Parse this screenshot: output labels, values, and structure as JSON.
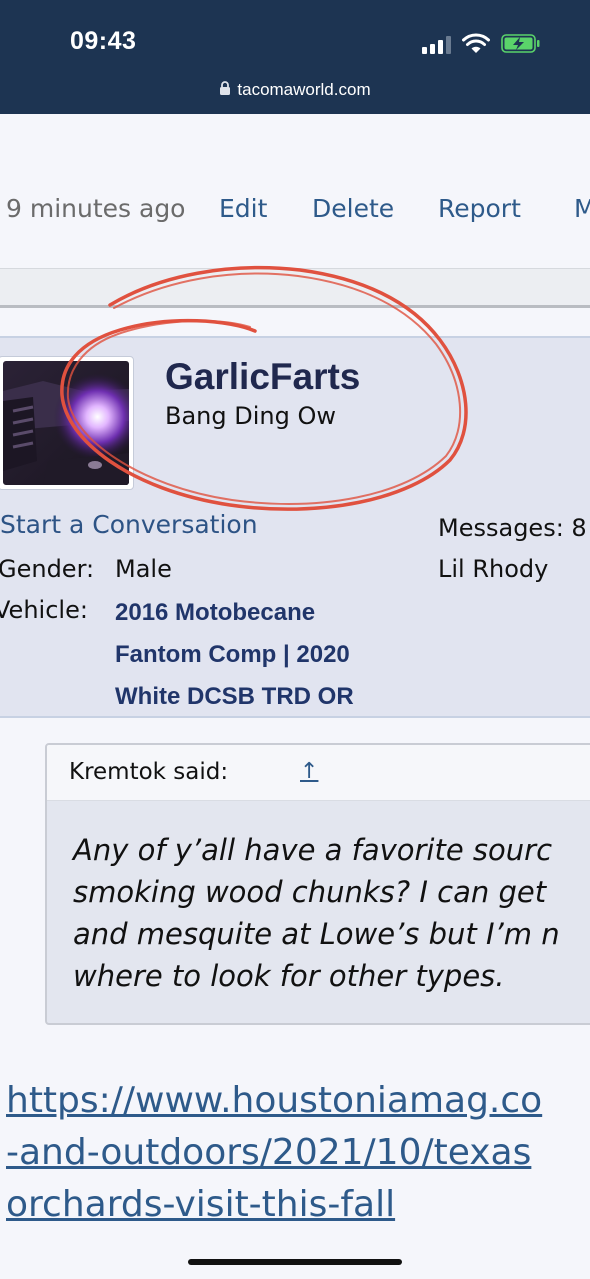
{
  "status_bar": {
    "time": "09:43",
    "url": "tacomaworld.com",
    "icons": [
      "signal-icon",
      "wifi-icon",
      "battery-charging-icon",
      "lock-icon"
    ]
  },
  "post_actions": {
    "time_ago": "9 minutes ago",
    "edit": "Edit",
    "delete": "Delete",
    "report": "Report",
    "more": "M"
  },
  "user": {
    "name": "GarlicFarts",
    "title": "Bang Ding Ow",
    "start_conversation": "Start a Conversation",
    "messages_label": "Messages:",
    "messages_value": "8",
    "location": "Lil Rhody",
    "gender_label": "Gender:",
    "gender_value": "Male",
    "vehicle_label": "Vehicle:",
    "vehicle_lines": [
      "2016 Motobecane",
      "Fantom Comp | 2020",
      "White DCSB TRD OR"
    ]
  },
  "quote": {
    "author": "Kremtok said:",
    "jump_icon": "↑",
    "lines": [
      "Any of y’all have a favorite sourc",
      "smoking wood chunks? I can get",
      "and mesquite at Lowe’s but I’m n",
      "where to look for other types."
    ]
  },
  "link": {
    "lines": [
      "https://www.houstoniamag.co",
      "-and-outdoors/2021/10/texas",
      "orchards-visit-this-fall"
    ]
  },
  "colors": {
    "status_bar_bg": "#1d3452",
    "link": "#2e5a8a",
    "username": "#20284e",
    "annotation": "#e0513f"
  }
}
